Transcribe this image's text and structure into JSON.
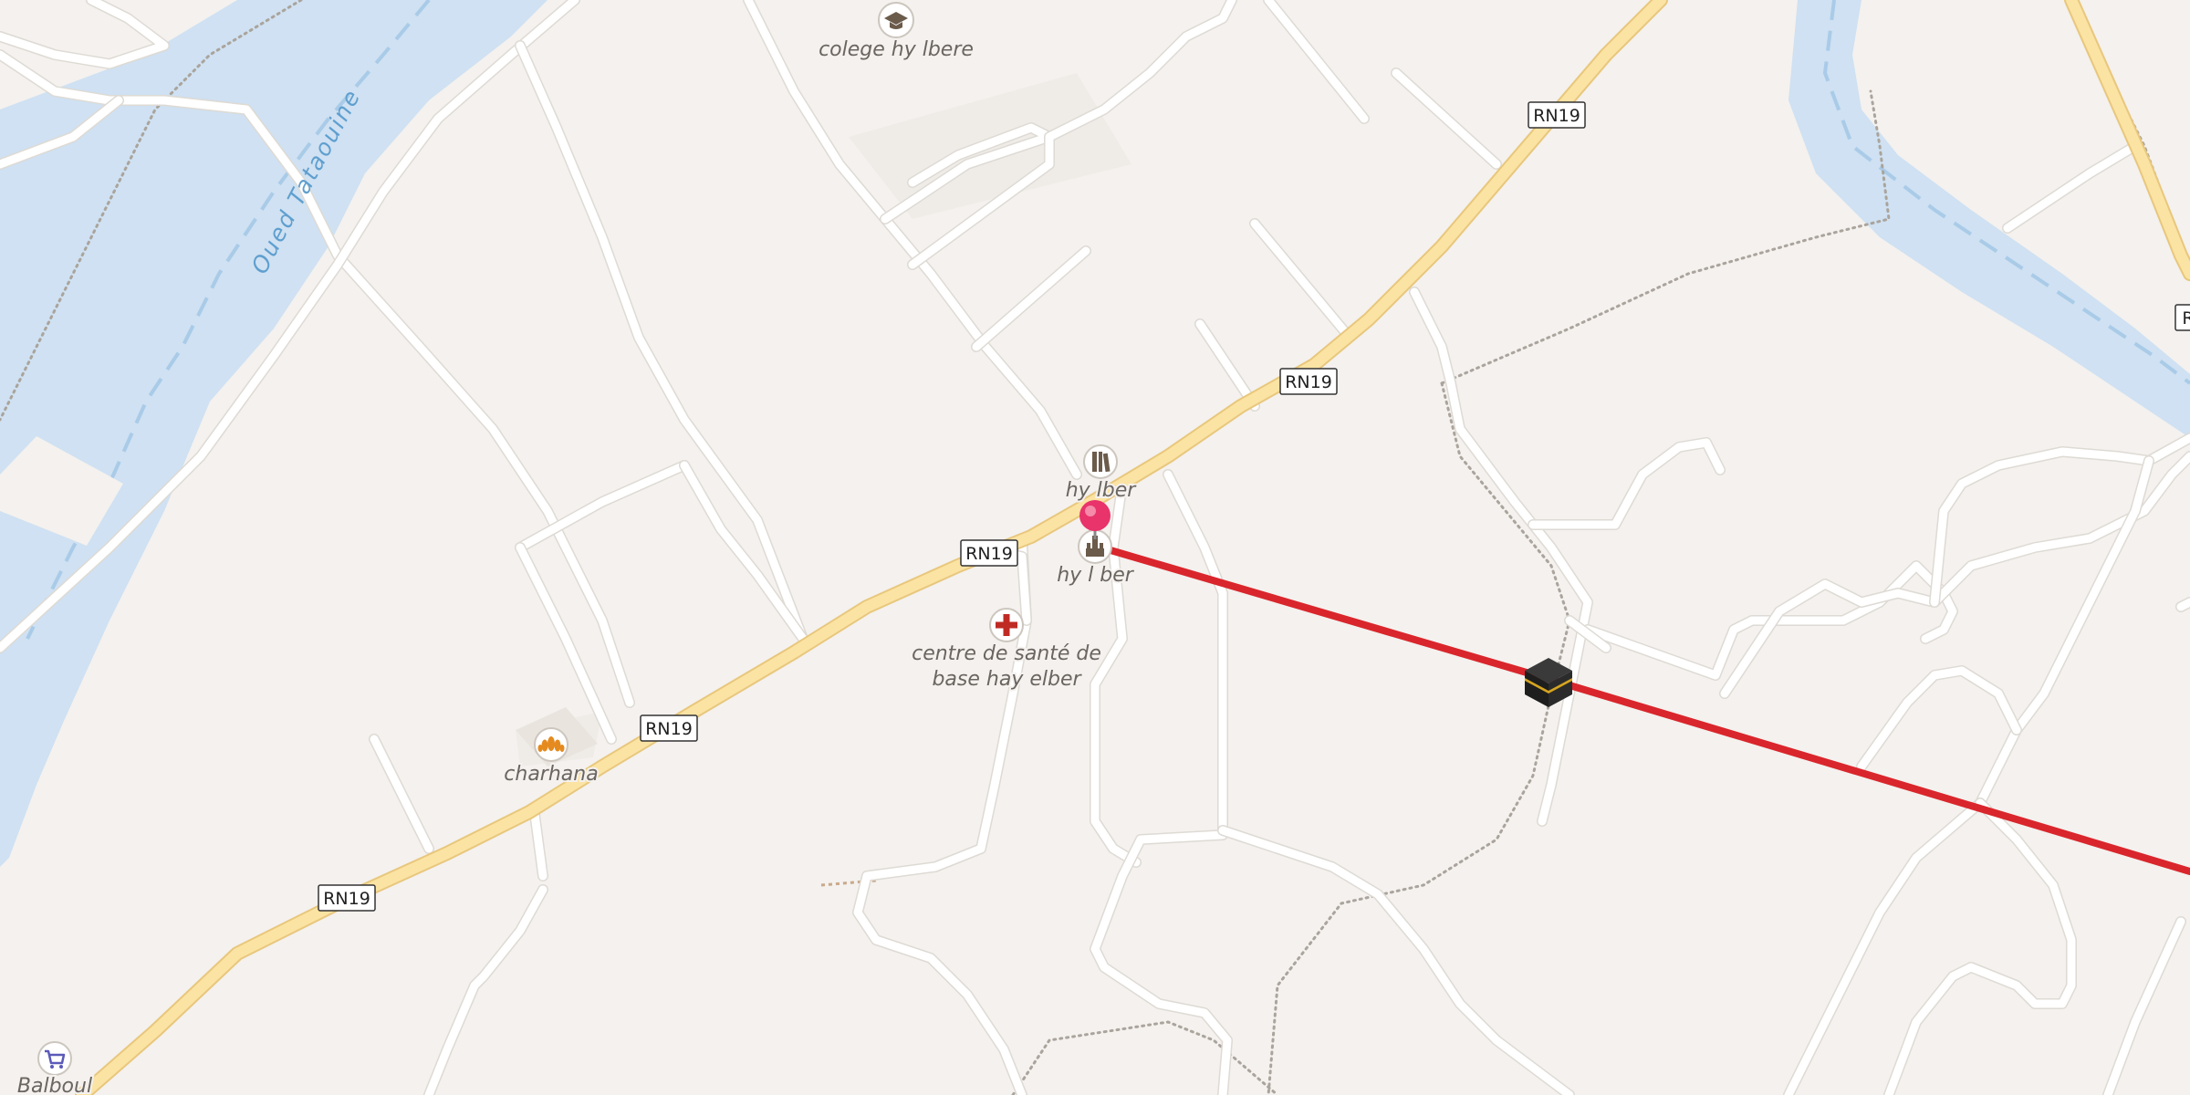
{
  "map": {
    "type": "street-map",
    "colors": {
      "land": "#f4f1ee",
      "water": "#cfe1f2",
      "river_line": "#a9cbe8",
      "primary_road": "#fbe3a3",
      "primary_road_casing": "#e8c77d",
      "minor_road": "#ffffff",
      "route_line": "#d9262c",
      "marker": "#e8336b"
    },
    "water_labels": [
      {
        "id": "oued",
        "text": "Oued Tataouine"
      }
    ],
    "road_shields": [
      {
        "id": "s1",
        "text": "RN19"
      },
      {
        "id": "s2",
        "text": "RN19"
      },
      {
        "id": "s3",
        "text": "RN19"
      },
      {
        "id": "s4",
        "text": "RN19"
      },
      {
        "id": "s5",
        "text": "RN19"
      },
      {
        "id": "s6",
        "text": "R"
      }
    ],
    "pois": [
      {
        "id": "college",
        "icon": "graduation-cap-icon",
        "label": "colege hy lbere"
      },
      {
        "id": "library",
        "icon": "library-icon",
        "label": "hy lber"
      },
      {
        "id": "townhall",
        "icon": "town-hall-icon",
        "label": "hy l ber"
      },
      {
        "id": "clinic",
        "icon": "red-cross-icon",
        "label_line1": "centre de santé de",
        "label_line2": "base hay elber"
      },
      {
        "id": "bakery",
        "icon": "croissant-icon",
        "label": "charhana"
      },
      {
        "id": "shop",
        "icon": "shopping-cart-icon",
        "label": "Balboul"
      },
      {
        "id": "mosque",
        "icon": "kaaba-icon",
        "label": ""
      }
    ],
    "marker": {
      "icon": "location-pin-icon"
    }
  }
}
